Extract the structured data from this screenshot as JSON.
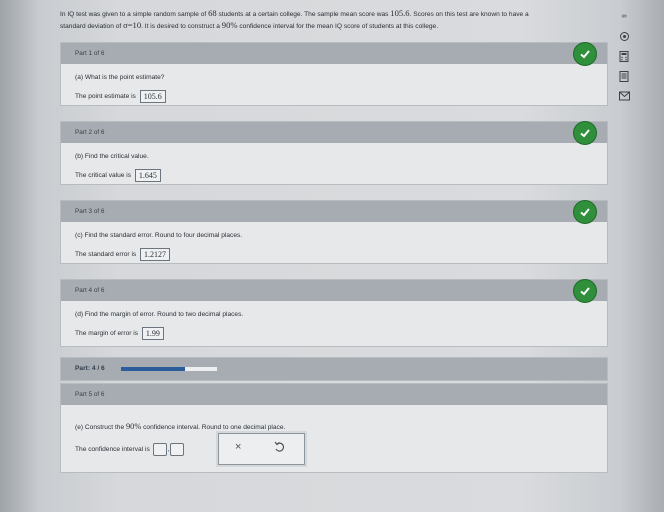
{
  "problem": {
    "text1": "In IQ test was given to a simple random sample of ",
    "n": "68",
    "text2": " students at a certain college. The sample mean score was ",
    "mean": "105.6",
    "text3": ". Scores on this test are known to have a",
    "text4": "standard deviation of ",
    "sigma": "σ=10",
    "text5": ". It is desired to construct a ",
    "conf": "90%",
    "text6": " confidence interval for the mean IQ score of students at this college."
  },
  "parts": [
    {
      "header": "Part 1 of 6",
      "question": "(a) What is the point estimate?",
      "answer_label": "The point estimate is",
      "answer": "105.6"
    },
    {
      "header": "Part 2 of 6",
      "question": "(b) Find the critical value.",
      "answer_label": "The critical value is",
      "answer": "1.645"
    },
    {
      "header": "Part 3 of 6",
      "question": "(c) Find the standard error. Round to four decimal places.",
      "answer_label": "The standard error is",
      "answer": "1.2127"
    },
    {
      "header": "Part 4 of 6",
      "question": "(d) Find the margin of error. Round to two decimal places.",
      "answer_label": "The margin of error is",
      "answer": "1.99"
    }
  ],
  "progress": {
    "label": "Part: 4 / 6",
    "fraction": 0.6667
  },
  "part5": {
    "header": "Part 5 of 6",
    "q1": "(e) Construct the ",
    "conf": "90%",
    "q2": " confidence interval. Round to one decimal place.",
    "answer_label": "The confidence interval is",
    "comma": ","
  },
  "actions": {
    "clear": "×",
    "undo_icon": "undo-icon"
  },
  "sidebar": {
    "top_glyph": "∞",
    "icons": [
      "gear-icon",
      "calculator-icon",
      "book-icon",
      "mail-icon"
    ]
  },
  "colors": {
    "check": "#2f8f3a",
    "progress": "#2b5d9b",
    "header": "#a6acb2"
  }
}
